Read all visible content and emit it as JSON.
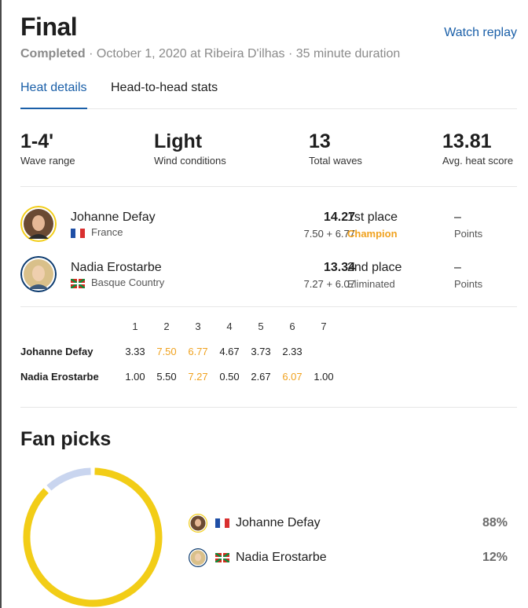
{
  "header": {
    "title": "Final",
    "watch_replay": "Watch replay",
    "status": "Completed",
    "details": " · October 1, 2020 at Ribeira D'ilhas · 35 minute duration"
  },
  "tabs": [
    {
      "label": "Heat details",
      "active": true
    },
    {
      "label": "Head-to-head stats",
      "active": false
    }
  ],
  "stats": [
    {
      "value": "1-4'",
      "label": "Wave range"
    },
    {
      "value": "Light",
      "label": "Wind conditions"
    },
    {
      "value": "13",
      "label": "Total waves"
    },
    {
      "value": "13.81",
      "label": "Avg. heat score"
    }
  ],
  "athletes": [
    {
      "name": "Johanne Defay",
      "country": "France",
      "flag": "france-flag",
      "total": "14.27",
      "breakdown": "7.50 + 6.77",
      "place": "1st place",
      "result": "Champion",
      "points_value": "–",
      "points_label": "Points",
      "ring_color": "#f2cd17"
    },
    {
      "name": "Nadia Erostarbe",
      "country": "Basque Country",
      "flag": "basque-flag",
      "total": "13.34",
      "breakdown": "7.27 + 6.07",
      "place": "2nd place",
      "result": "Eliminated",
      "points_value": "–",
      "points_label": "Points",
      "ring_color": "#0b3a6e"
    }
  ],
  "waves": {
    "headers": [
      "1",
      "2",
      "3",
      "4",
      "5",
      "6",
      "7"
    ],
    "rows": [
      {
        "name": "Johanne Defay",
        "scores": [
          "3.33",
          "7.50",
          "6.77",
          "4.67",
          "3.73",
          "2.33",
          ""
        ],
        "highlight": [
          1,
          2
        ]
      },
      {
        "name": "Nadia Erostarbe",
        "scores": [
          "1.00",
          "5.50",
          "7.27",
          "0.50",
          "2.67",
          "6.07",
          "1.00"
        ],
        "highlight": [
          2,
          5
        ]
      }
    ]
  },
  "fan_picks": {
    "title": "Fan picks",
    "picks": [
      {
        "name": "Johanne Defay",
        "percent": "88%",
        "value": 88,
        "color": "#f2cd17"
      },
      {
        "name": "Nadia Erostarbe",
        "percent": "12%",
        "value": 12,
        "color": "#c9d5ef"
      }
    ]
  },
  "colors": {
    "accent_blue": "#1a5fa8",
    "highlight_orange": "#f0a21f",
    "divider": "#e6e6e6"
  }
}
